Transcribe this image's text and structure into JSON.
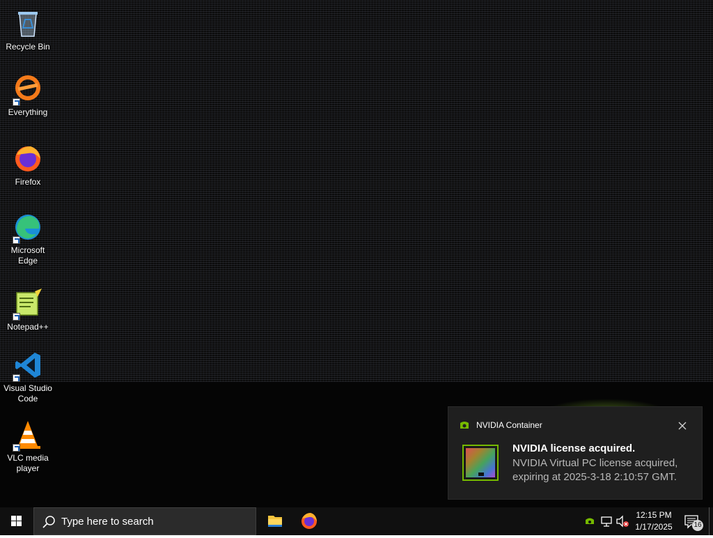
{
  "desktop": {
    "icons": [
      {
        "label": "Recycle Bin",
        "icon": "recycle-bin-icon"
      },
      {
        "label": "Everything",
        "icon": "everything-icon"
      },
      {
        "label": "Firefox",
        "icon": "firefox-icon"
      },
      {
        "label": "Microsoft Edge",
        "icon": "edge-icon"
      },
      {
        "label": "Notepad++",
        "icon": "notepadpp-icon"
      },
      {
        "label": "Visual Studio Code",
        "icon": "vscode-icon"
      },
      {
        "label": "VLC media player",
        "icon": "vlc-icon"
      }
    ]
  },
  "notification": {
    "app_name": "NVIDIA Container",
    "title": "NVIDIA license acquired.",
    "body": "NVIDIA Virtual PC license acquired, expiring at 2025-3-18 2:10:57 GMT.",
    "accent": "#76b900"
  },
  "taskbar": {
    "search_placeholder": "Type here to search",
    "pinned": [
      {
        "name": "File Explorer",
        "icon": "file-explorer-icon"
      },
      {
        "name": "Firefox",
        "icon": "firefox-icon"
      }
    ],
    "tray": {
      "time": "12:15 PM",
      "date": "1/17/2025",
      "notification_count": "16"
    }
  },
  "colors": {
    "taskbar_bg": "#101010",
    "toast_bg": "#1f1f1f",
    "nvidia_green": "#76b900"
  }
}
